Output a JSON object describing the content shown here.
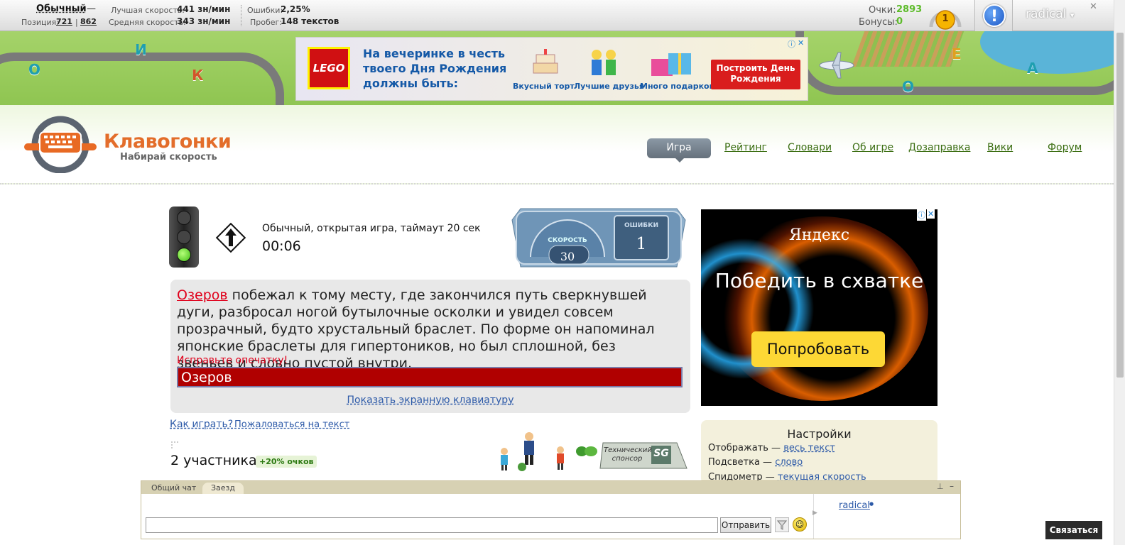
{
  "topbar": {
    "mode": "Обычный",
    "mode_dash": "—",
    "position_label": "Позиция:",
    "position_a": "721",
    "position_sep": "|",
    "position_b": "862",
    "best_speed_label": "Лучшая скорость:",
    "best_speed": "441 зн/мин",
    "avg_speed_label": "Средняя скорость:",
    "avg_speed": "343 зн/мин",
    "errors_label": "Ошибки:",
    "errors": "2,25%",
    "mileage_label": "Пробег:",
    "mileage": "148 текстов",
    "points_label": "Очки:",
    "points": "2893",
    "bonus_label": "Бонусы:",
    "bonus": "0",
    "level_badge": "1",
    "alert_icon": "!",
    "username": "radical",
    "dropdown_icon": "▾",
    "close_icon": "✕"
  },
  "banner_ad": {
    "brand": "LEGO",
    "headline": "На вечеринке в честь твоего Дня Рождения должны быть:",
    "item1": "Вкусный торт",
    "item2": "Лучшие друзья",
    "item3": "Много подарков",
    "cta": "Построить День Рождения",
    "info_icon": "ⓘ",
    "close_icon": "✕"
  },
  "header": {
    "logo_title": "Клавогонки",
    "logo_tagline": "Набирай скорость",
    "nav": [
      "Игра",
      "Рейтинг",
      "Словари",
      "Об игре",
      "Дозаправка",
      "Вики",
      "Форум"
    ]
  },
  "game": {
    "status": "Обычный, открытая игра, таймаут 20 сек",
    "timer": "00:06",
    "speed_label": "СКОРОСТЬ",
    "speed": "30",
    "errors_label": "ОШИБКИ",
    "errors": "1",
    "text_done": "Озеров",
    "text_rest": " побежал к тому месту, где закончился путь сверкнувшей дуги, разбросал ногой бутылочные осколки и увидел совсем прозрачный, будто хрустальный браслет. По форме он напоминал японские браслеты для гипертоников, но был сплошной, без звеньев и словно пустой внутри.",
    "fix_typo": "Исправьте опечатку!",
    "input_value": "Озеров",
    "show_keyboard": "Показать экранную клавиатуру",
    "how_to_play": "Как играть?",
    "complain": "Пожаловаться на текст",
    "participants": "2 участника",
    "bonus_badge": "+20% очков",
    "sponsor_label": "Технический спонсор",
    "sponsor_logo": "SG"
  },
  "side_ad": {
    "brand": "Яндекс",
    "headline": "Победить в схватке",
    "cta": "Попробовать",
    "info_icon": "ⓘ",
    "close_icon": "✕"
  },
  "settings": {
    "title": "Настройки",
    "rows": [
      {
        "label": "Отображать —",
        "value": "весь текст"
      },
      {
        "label": "Подсветка —",
        "value": "слово"
      },
      {
        "label": "Спидометр —",
        "value": "текущая скорость"
      }
    ]
  },
  "chat": {
    "tabs": [
      "Общий чат",
      "Заезд"
    ],
    "input_value": "",
    "send": "Отправить",
    "smile_icon": "☺",
    "user": "radical",
    "user_info_icon": "●",
    "pin_icon": "⊥",
    "minimize_icon": "–"
  },
  "contact": "Связаться"
}
